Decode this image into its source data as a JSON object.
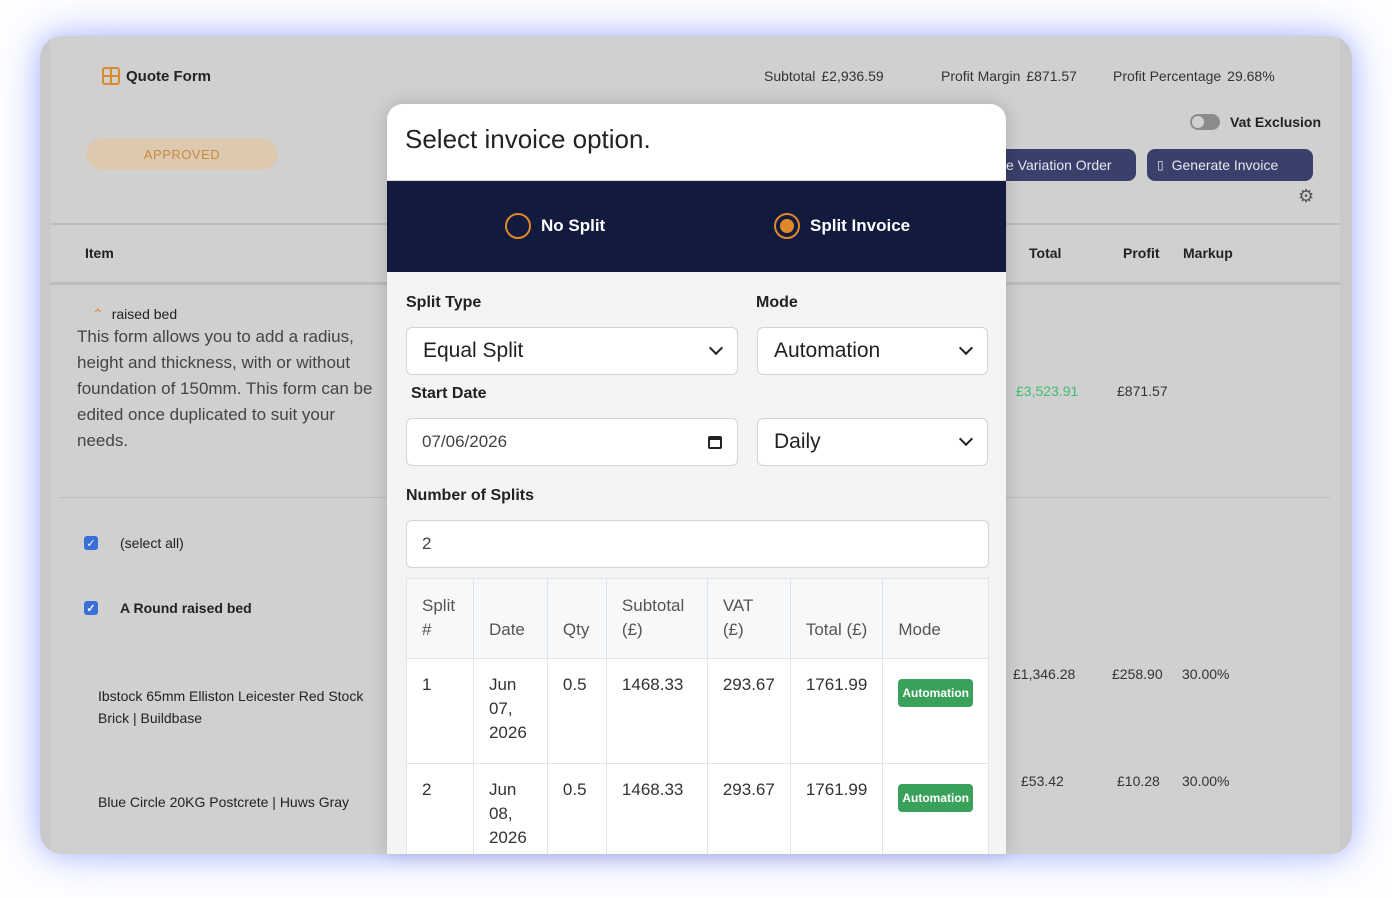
{
  "header": {
    "title": "Quote Form",
    "subtotal_label": "Subtotal",
    "subtotal_value": "£2,936.59",
    "margin_label": "Profit Margin",
    "margin_value": "£871.57",
    "percentage_label": "Profit Percentage",
    "percentage_value": "29.68%",
    "status_badge": "APPROVED",
    "vat_label": "Vat Exclusion",
    "variation_button": "e Variation Order",
    "generate_button": "Generate Invoice"
  },
  "table_header": {
    "item": "Item",
    "total": "Total",
    "profit": "Profit",
    "markup": "Markup"
  },
  "group": {
    "name": "raised bed",
    "description": "This form allows you to add a radius, height and thickness, with or without foundation of 150mm. This form can be edited once duplicated to suit your needs.",
    "total": "£3,523.91",
    "profit": "£871.57",
    "select_all": "(select all)",
    "section_title": "A Round raised bed"
  },
  "items": [
    {
      "name": "Ibstock 65mm Elliston Leicester Red Stock Brick | Buildbase",
      "total": "£1,346.28",
      "profit": "£258.90",
      "markup": "30.00%"
    },
    {
      "name": "Blue Circle 20KG Postcrete | Huws Gray",
      "total": "£53.42",
      "profit": "£10.28",
      "markup": "30.00%"
    }
  ],
  "modal": {
    "title": "Select invoice option.",
    "options": [
      "No Split",
      "Split Invoice"
    ],
    "selected_option": "Split Invoice",
    "split_type_label": "Split Type",
    "split_type_value": "Equal Split",
    "mode_label": "Mode",
    "mode_value": "Automation",
    "start_date_label": "Start Date",
    "start_date_value": "07/06/2026",
    "frequency_value": "Daily",
    "num_splits_label": "Number of Splits",
    "num_splits_value": "2",
    "columns": [
      "Split #",
      "Date",
      "Qty",
      "Subtotal (£)",
      "VAT (£)",
      "Total (£)",
      "Mode"
    ],
    "rows": [
      {
        "split": "1",
        "date": "Jun 07, 2026",
        "qty": "0.5",
        "subtotal": "1468.33",
        "vat": "293.67",
        "total": "1761.99",
        "mode": "Automation"
      },
      {
        "split": "2",
        "date": "Jun 08, 2026",
        "qty": "0.5",
        "subtotal": "1468.33",
        "vat": "293.67",
        "total": "1761.99",
        "mode": "Automation"
      }
    ]
  },
  "colors": {
    "accent": "#e0892a",
    "option_bar": "#121a3e",
    "mode_pill": "#3aa15a",
    "positive_total": "#3fbf6f"
  }
}
